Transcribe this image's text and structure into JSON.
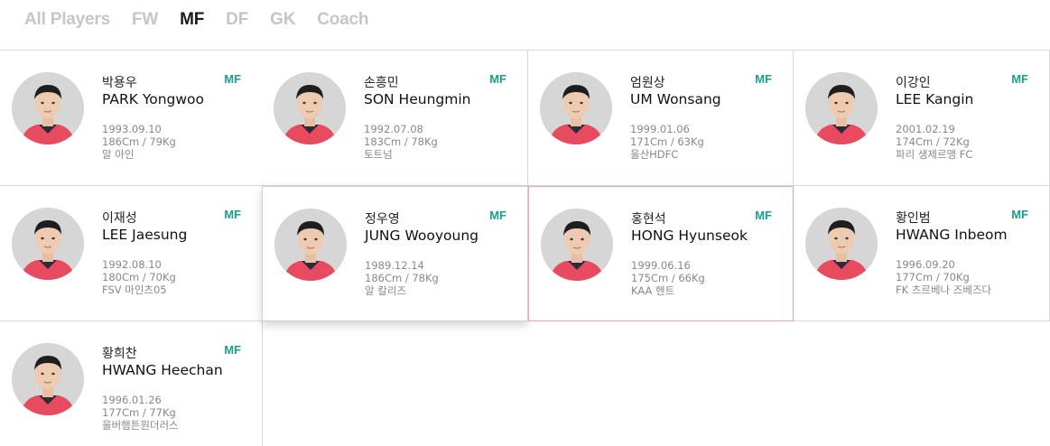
{
  "tabs": [
    {
      "label": "All Players",
      "active": false
    },
    {
      "label": "FW",
      "active": false
    },
    {
      "label": "MF",
      "active": true
    },
    {
      "label": "DF",
      "active": false
    },
    {
      "label": "GK",
      "active": false
    },
    {
      "label": "Coach",
      "active": false
    }
  ],
  "colors": {
    "position": "#1a9f8d",
    "jersey": "#e84a5f",
    "accent_border": "#e6a7a7"
  },
  "players": [
    {
      "name_ko": "박용우",
      "name_en": "PARK Yongwoo",
      "position": "MF",
      "birth": "1993.09.10",
      "body": "186Cm / 79Kg",
      "club": "알 아인"
    },
    {
      "name_ko": "손흥민",
      "name_en": "SON Heungmin",
      "position": "MF",
      "birth": "1992.07.08",
      "body": "183Cm / 78Kg",
      "club": "토트넘"
    },
    {
      "name_ko": "엄원상",
      "name_en": "UM Wonsang",
      "position": "MF",
      "birth": "1999.01.06",
      "body": "171Cm / 63Kg",
      "club": "울산HDFC"
    },
    {
      "name_ko": "이강인",
      "name_en": "LEE Kangin",
      "position": "MF",
      "birth": "2001.02.19",
      "body": "174Cm / 72Kg",
      "club": "파리 생제르맹 FC"
    },
    {
      "name_ko": "이재성",
      "name_en": "LEE Jaesung",
      "position": "MF",
      "birth": "1992.08.10",
      "body": "180Cm / 70Kg",
      "club": "FSV 마인츠05"
    },
    {
      "name_ko": "정우영",
      "name_en": "JUNG Wooyoung",
      "position": "MF",
      "birth": "1989.12.14",
      "body": "186Cm / 78Kg",
      "club": "알 칼리즈"
    },
    {
      "name_ko": "홍현석",
      "name_en": "HONG Hyunseok",
      "position": "MF",
      "birth": "1999.06.16",
      "body": "175Cm / 66Kg",
      "club": "KAA 헨트"
    },
    {
      "name_ko": "황인범",
      "name_en": "HWANG Inbeom",
      "position": "MF",
      "birth": "1996.09.20",
      "body": "177Cm / 70Kg",
      "club": "FK 츠르베나 즈베즈다"
    },
    {
      "name_ko": "황희찬",
      "name_en": "HWANG Heechan",
      "position": "MF",
      "birth": "1996.01.26",
      "body": "177Cm / 77Kg",
      "club": "울버햄튼원더러스"
    }
  ]
}
